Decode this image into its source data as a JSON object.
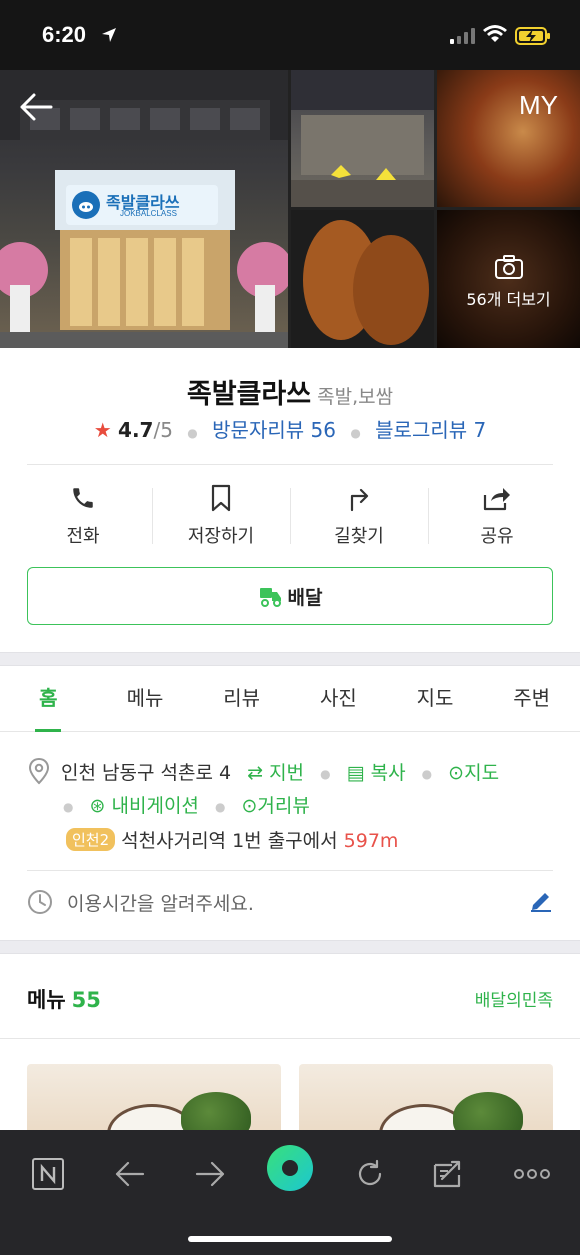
{
  "status_bar": {
    "time": "6:20"
  },
  "hero": {
    "my_label": "MY",
    "more_photos": "56개 더보기",
    "sign_text": "족발클라쓰",
    "sign_sub": "JOKBALCLASS"
  },
  "place": {
    "name": "족발클라쓰",
    "category": "족발,보쌈",
    "rating": "4.7",
    "rating_max": "/5",
    "visitor_reviews": "방문자리뷰 56",
    "blog_reviews": "블로그리뷰 7"
  },
  "actions": [
    {
      "label": "전화",
      "icon": "phone-icon"
    },
    {
      "label": "저장하기",
      "icon": "bookmark-icon"
    },
    {
      "label": "길찾기",
      "icon": "directions-icon"
    },
    {
      "label": "공유",
      "icon": "share-icon"
    }
  ],
  "delivery_button": "배달",
  "tabs": [
    "홈",
    "메뉴",
    "리뷰",
    "사진",
    "지도",
    "주변"
  ],
  "active_tab": "홈",
  "info": {
    "address": "인천 남동구 석촌로 4",
    "jibun": "지번",
    "copy": "복사",
    "map": "지도",
    "navigation": "내비게이션",
    "street_view": "거리뷰",
    "subway_line": "인천2",
    "station": "석천사거리역",
    "exit_text": "1번 출구에서",
    "distance": "597m",
    "hours_prompt": "이용시간을 알려주세요."
  },
  "menu": {
    "title": "메뉴",
    "count": "55",
    "source": "배달의민족"
  },
  "colors": {
    "accent_green": "#2fb34b",
    "link_blue": "#2a66b7",
    "star_red": "#e84c3d",
    "distance_red": "#e8524a",
    "subway_badge": "#f1c15d"
  }
}
